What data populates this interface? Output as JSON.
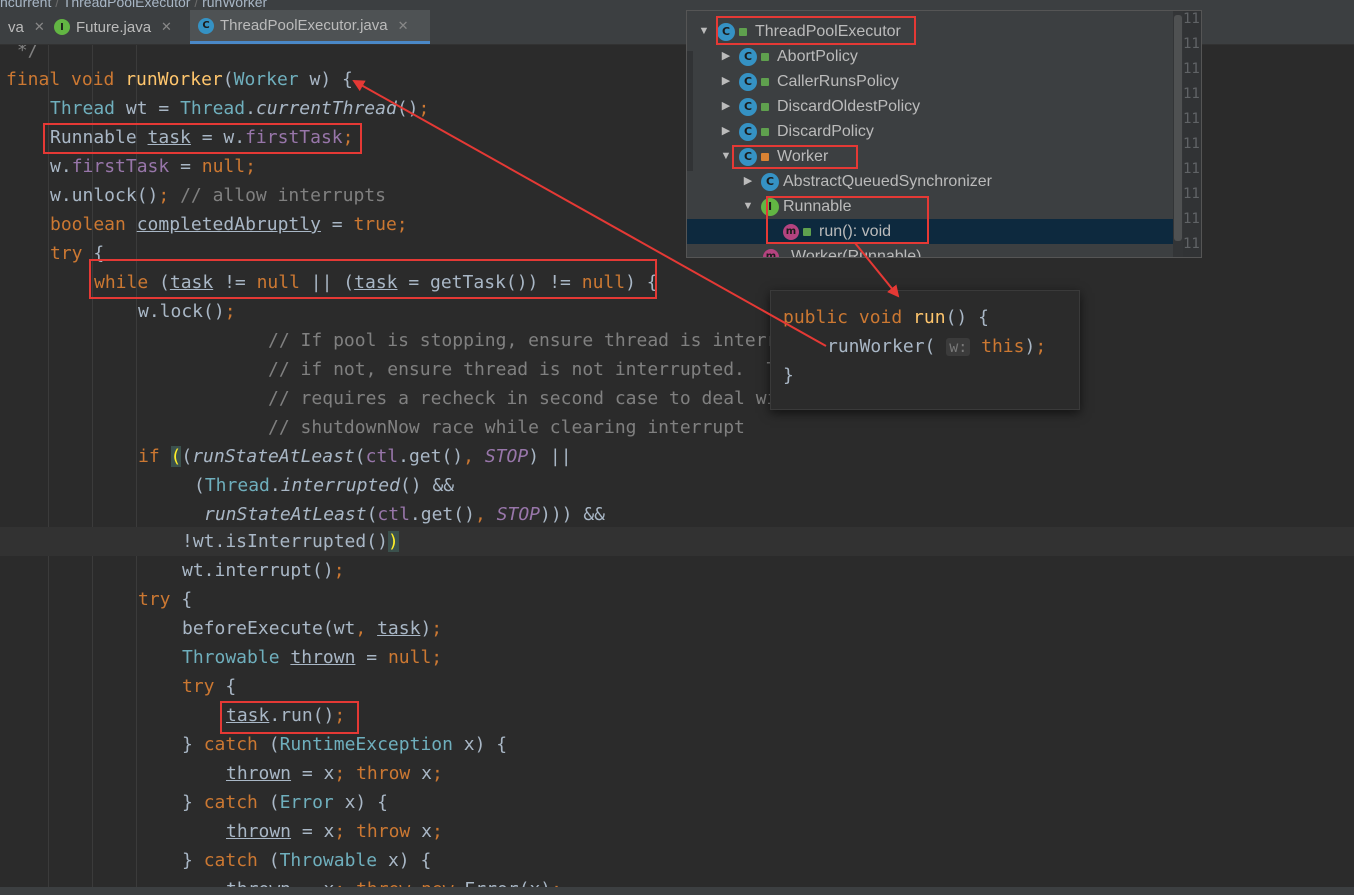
{
  "breadcrumb": [
    "ncurrent",
    "ThreadPoolExecutor",
    "runWorker"
  ],
  "tabs": [
    {
      "label": "va",
      "icon": "",
      "active": false
    },
    {
      "label": "Future.java",
      "icon": "interface-icon",
      "active": false
    },
    {
      "label": "ThreadPoolExecutor.java",
      "icon": "class-icon",
      "active": true
    }
  ],
  "structure_popup": {
    "items": [
      {
        "label": "ThreadPoolExecutor",
        "expanded": true
      },
      {
        "label": "AbortPolicy",
        "expanded": false
      },
      {
        "label": "CallerRunsPolicy",
        "expanded": false
      },
      {
        "label": "DiscardOldestPolicy",
        "expanded": false
      },
      {
        "label": "DiscardPolicy",
        "expanded": false
      },
      {
        "label": "Worker",
        "expanded": true
      },
      {
        "label": "AbstractQueuedSynchronizer",
        "expanded": false
      },
      {
        "label": "Runnable",
        "expanded": true
      },
      {
        "label": "run(): void",
        "selected": true
      },
      {
        "label": "Worker(Runnable)"
      }
    ],
    "gutter_numbers": [
      "11",
      "11",
      "11",
      "11",
      "11",
      "11",
      "11",
      "11",
      "11",
      "11"
    ]
  },
  "run_popup": {
    "lines": [
      "public void run() {",
      "    runWorker( w: this);",
      "}"
    ],
    "param_hint": "w:"
  },
  "code_lines": [
    " */",
    "final void runWorker(Worker w) {",
    "    Thread wt = Thread.currentThread();",
    "    Runnable task = w.firstTask;",
    "    w.firstTask = null;",
    "    w.unlock(); // allow interrupts",
    "    boolean completedAbruptly = true;",
    "    try {",
    "        while (task != null || (task = getTask()) != null) {",
    "            w.lock();",
    "            // If pool is stopping, ensure thread is interrupted;",
    "            // if not, ensure thread is not interrupted.  This",
    "            // requires a recheck in second case to deal with",
    "            // shutdownNow race while clearing interrupt",
    "            if ((runStateAtLeast(ctl.get(), STOP) ||",
    "                 (Thread.interrupted() &&",
    "                  runStateAtLeast(ctl.get(), STOP))) &&",
    "                !wt.isInterrupted())",
    "                wt.interrupt();",
    "            try {",
    "                beforeExecute(wt, task);",
    "                Throwable thrown = null;",
    "                try {",
    "                    task.run();",
    "                } catch (RuntimeException x) {",
    "                    thrown = x; throw x;",
    "                } catch (Error x) {",
    "                    thrown = x; throw x;",
    "                } catch (Throwable x) {",
    "                    thrown = x; throw new Error(x);"
  ],
  "colors": {
    "keyword": "#cc7832",
    "method": "#ffc66d",
    "type": "#6fafbd",
    "comment": "#808080",
    "field": "#9876aa",
    "annotation_red": "#e53935",
    "selection": "#0d293e"
  }
}
